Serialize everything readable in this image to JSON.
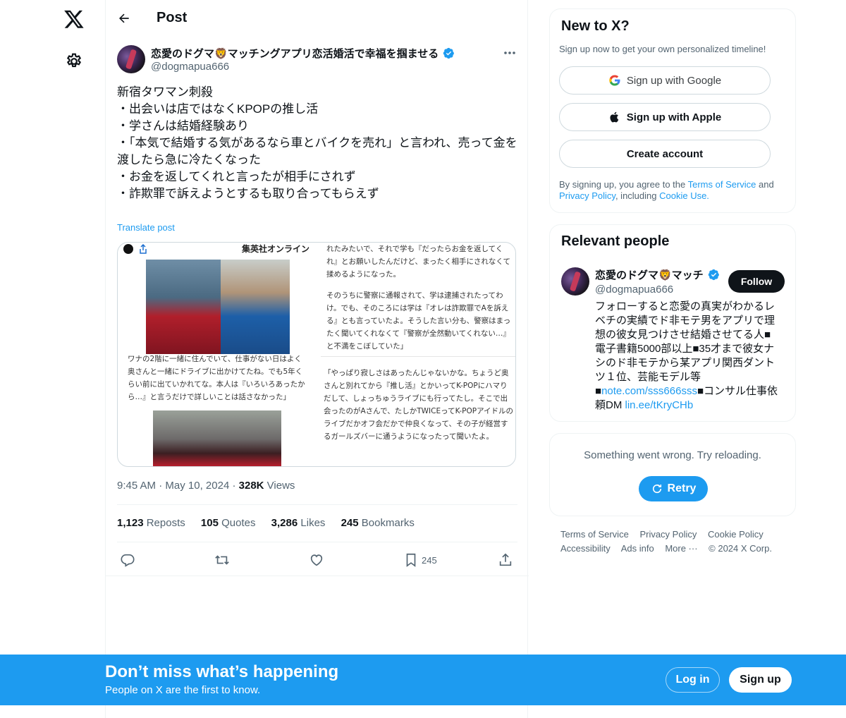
{
  "header": {
    "title": "Post"
  },
  "tweet": {
    "author_name": "恋愛のドグマ🦁マッチングアプリ恋活婚活で幸福を掴ませる",
    "author_handle": "@dogmapua666",
    "text_lines": [
      "新宿タワマン刺殺",
      "",
      "・出会いは店ではなくKPOPの推し活",
      "・学さんは結婚経験あり",
      "・「本気で結婚する気があるなら車とバイクを売れ」と言われ、売って金を渡したら急に冷たくなった",
      "・お金を返してくれと言ったが相手にされず",
      "・詐欺罪で訴えようとするも取り合ってもらえず"
    ],
    "translate_label": "Translate post",
    "time": "9:45 AM",
    "date": "May 10, 2024",
    "views_count": "328K",
    "views_label": "Views",
    "stats": {
      "reposts_count": "1,123",
      "reposts_label": "Reposts",
      "quotes_count": "105",
      "quotes_label": "Quotes",
      "likes_count": "3,286",
      "likes_label": "Likes",
      "bookmarks_count": "245",
      "bookmarks_label": "Bookmarks"
    },
    "bookmark_action_count": "245"
  },
  "media": {
    "brand": "集英社オンライン",
    "right_text_1": "れたみたいで、それで学も『だったらお金を返してくれ』とお願いしたんだけど、まったく相手にされなくて揉めるようになった。",
    "right_text_2": "そのうちに警察に通報されて、学は逮捕されたってわけ。でも、そのころには学は『オレは詐欺罪でAを訴える』とも言っていたよ。そうした言い分も、警察はまったく聞いてくれなくて『警察が全然動いてくれない…』と不満をこぼしていた」",
    "left_text": "ワナの2階に一緒に住んでいて、仕事がない日はよく奥さんと一緒にドライブに出かけてたね。でも5年くらい前に出ていかれてな。本人は『いろいろあったから…』と言うだけで詳しいことは話さなかった」",
    "right_text_3": "「やっぱり寂しさはあったんじゃないかな。ちょうど奥さんと別れてから『推し活』とかいってK-POPにハマりだして、しょっちゅうライブにも行ってたし。そこで出会ったのがAさんで、たしかTWICEってK-POPアイドルのライブだかオフ会だかで仲良くなって、その子が経営するガールズバーに通うようになったって聞いたよ。"
  },
  "signup_card": {
    "title": "New to X?",
    "subtitle": "Sign up now to get your own personalized timeline!",
    "google_label": "Sign up with Google",
    "apple_label": "Sign up with Apple",
    "create_label": "Create account",
    "legal_prefix": "By signing up, you agree to the ",
    "terms": "Terms of Service",
    "and": " and",
    "privacy": "Privacy Policy",
    "including": ", including ",
    "cookie": "Cookie Use."
  },
  "relevant": {
    "title": "Relevant people",
    "name": "恋愛のドグマ🦁マッチ",
    "handle": "@dogmapua666",
    "follow_label": "Follow",
    "bio_text": "フォローすると恋愛の真実がわかるレベチの実績でド非モテ男をアプリで理想の彼女見つけさせ結婚させてる人■電子書籍5000部以上■35才まで彼女ナシのド非モテから某アプリ関西ダントツ１位、芸能モデル等■",
    "bio_link1": "note.com/sss666sss",
    "bio_mid": "■コンサル仕事依頼DM ",
    "bio_link2": "lin.ee/tKryCHb"
  },
  "error_card": {
    "message": "Something went wrong. Try reloading.",
    "retry_label": "Retry"
  },
  "footer": {
    "terms": "Terms of Service",
    "privacy": "Privacy Policy",
    "cookie": "Cookie Policy",
    "accessibility": "Accessibility",
    "ads": "Ads info",
    "more": "More ···",
    "copyright": "© 2024 X Corp."
  },
  "banner": {
    "title": "Don’t miss what’s happening",
    "subtitle": "People on X are the first to know.",
    "login_label": "Log in",
    "signup_label": "Sign up"
  },
  "colors": {
    "accent": "#1d9bf0",
    "text": "#0f1419",
    "muted": "#536471"
  }
}
